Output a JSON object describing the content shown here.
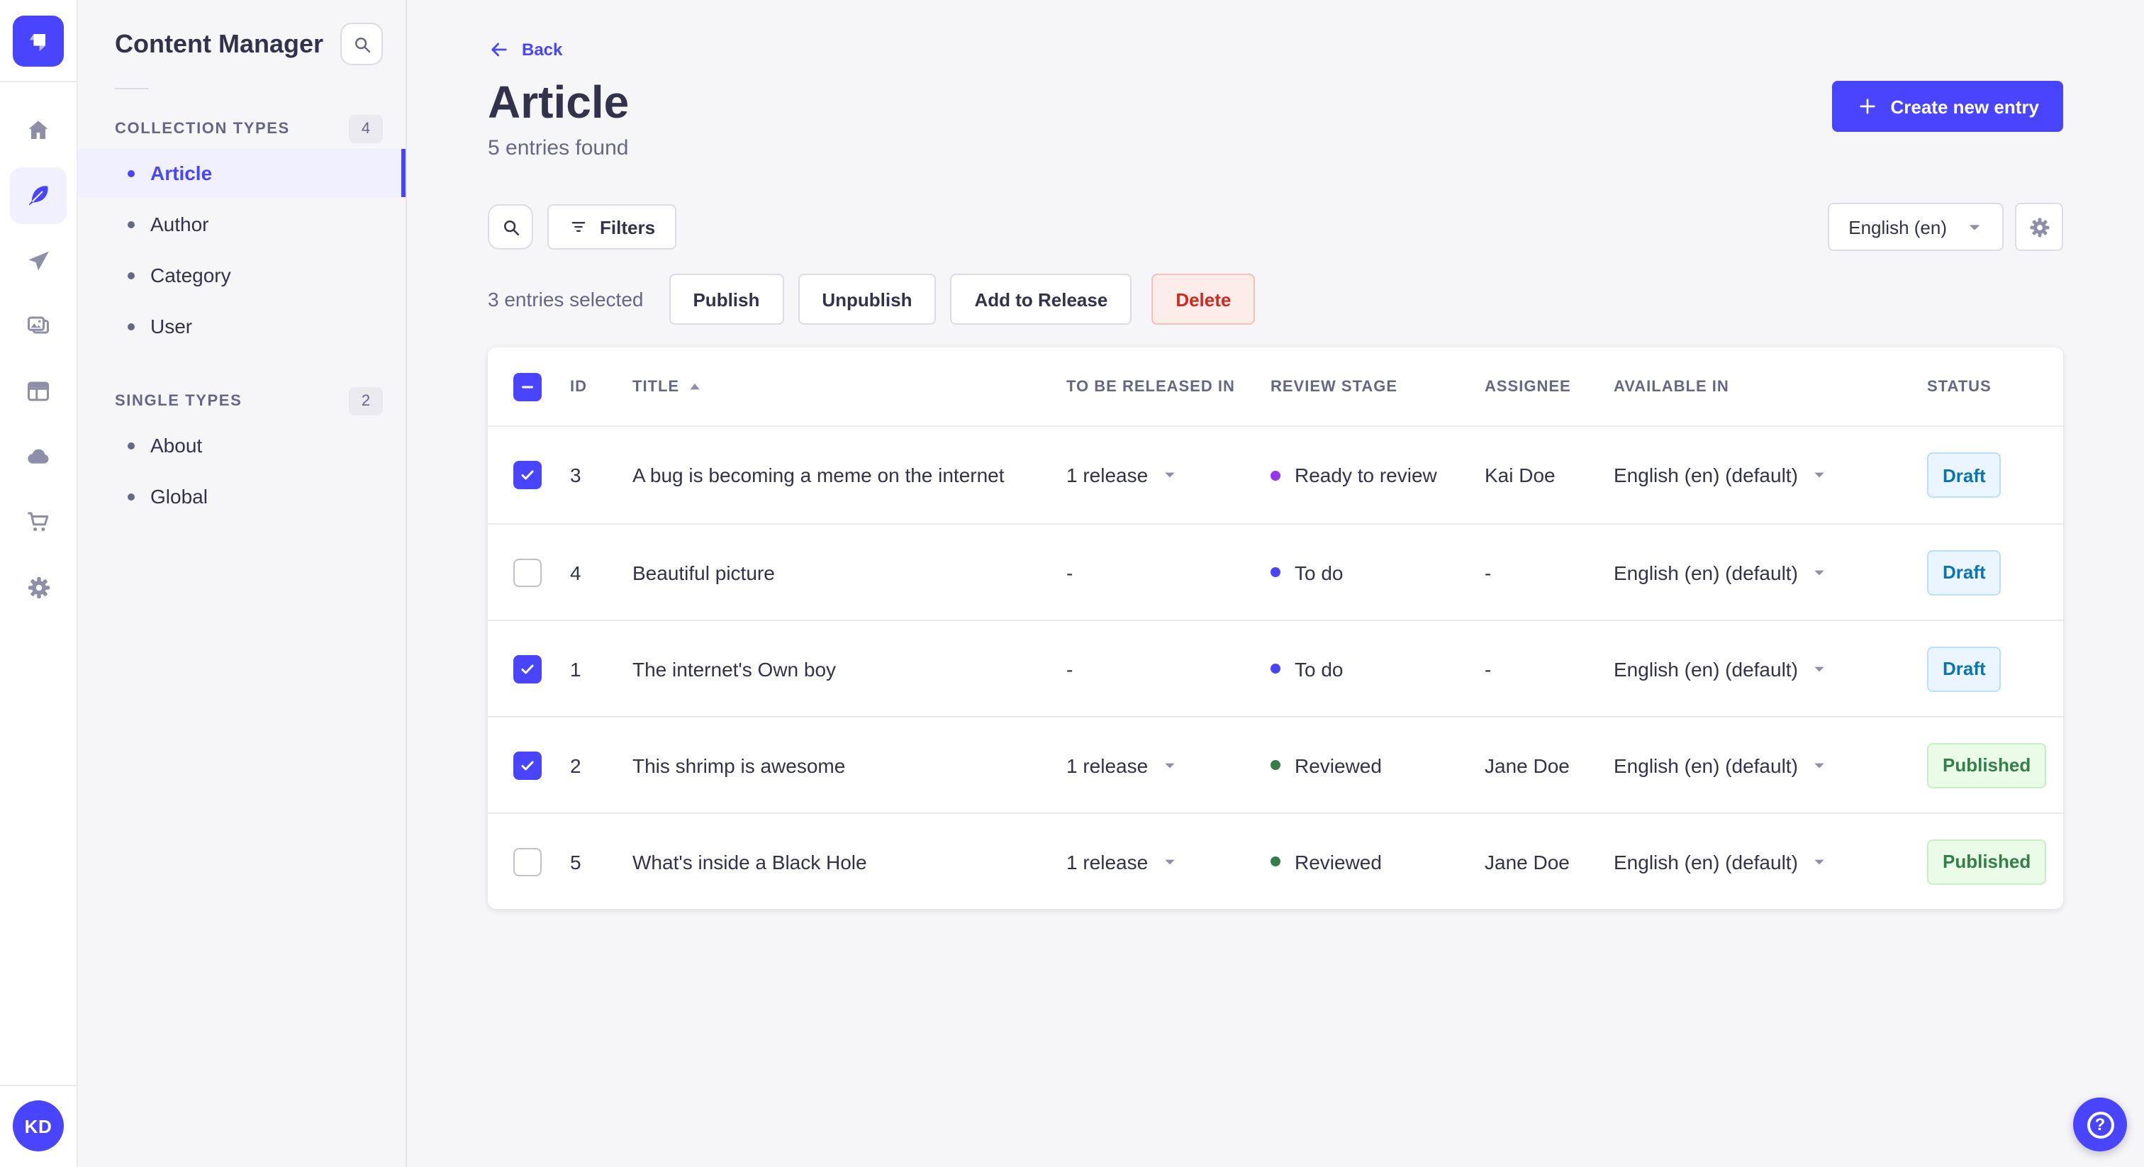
{
  "rail": {
    "avatar_initials": "KD",
    "items": [
      {
        "name": "home"
      },
      {
        "name": "content-manager",
        "active": true
      },
      {
        "name": "releases"
      },
      {
        "name": "media-library"
      },
      {
        "name": "content-type-builder"
      },
      {
        "name": "deploy"
      },
      {
        "name": "marketplace"
      },
      {
        "name": "settings"
      }
    ]
  },
  "subnav": {
    "title": "Content Manager",
    "sections": [
      {
        "label": "COLLECTION TYPES",
        "count": "4",
        "items": [
          {
            "label": "Article",
            "active": true
          },
          {
            "label": "Author"
          },
          {
            "label": "Category"
          },
          {
            "label": "User"
          }
        ]
      },
      {
        "label": "SINGLE TYPES",
        "count": "2",
        "items": [
          {
            "label": "About"
          },
          {
            "label": "Global"
          }
        ]
      }
    ]
  },
  "page": {
    "back_label": "Back",
    "title": "Article",
    "subtitle": "5 entries found",
    "create_button_label": "Create new entry"
  },
  "toolbar": {
    "filters_label": "Filters",
    "locale_value": "English (en)"
  },
  "selection": {
    "summary": "3 entries selected",
    "publish_label": "Publish",
    "unpublish_label": "Unpublish",
    "add_to_release_label": "Add to Release",
    "delete_label": "Delete"
  },
  "table": {
    "columns": {
      "id": "ID",
      "title": "TITLE",
      "release": "TO BE RELEASED IN",
      "stage": "REVIEW STAGE",
      "assignee": "ASSIGNEE",
      "available": "AVAILABLE IN",
      "status": "STATUS"
    },
    "sort": {
      "column": "TITLE",
      "direction": "ascending"
    },
    "rows": [
      {
        "selected": true,
        "id": "3",
        "title": "A bug is becoming a meme on the internet",
        "release": "1 release",
        "stage": "Ready to review",
        "stage_color": "#9736e8",
        "assignee": "Kai Doe",
        "available": "English (en) (default)",
        "status": "Draft"
      },
      {
        "selected": false,
        "id": "4",
        "title": "Beautiful picture",
        "release": "-",
        "stage": "To do",
        "stage_color": "#4945ff",
        "assignee": "-",
        "available": "English (en) (default)",
        "status": "Draft"
      },
      {
        "selected": true,
        "id": "1",
        "title": "The internet's Own boy",
        "release": "-",
        "stage": "To do",
        "stage_color": "#4945ff",
        "assignee": "-",
        "available": "English (en) (default)",
        "status": "Draft"
      },
      {
        "selected": true,
        "id": "2",
        "title": "This shrimp is awesome",
        "release": "1 release",
        "stage": "Reviewed",
        "stage_color": "#328048",
        "assignee": "Jane Doe",
        "available": "English (en) (default)",
        "status": "Published"
      },
      {
        "selected": false,
        "id": "5",
        "title": "What's inside a Black Hole",
        "release": "1 release",
        "stage": "Reviewed",
        "stage_color": "#328048",
        "assignee": "Jane Doe",
        "available": "English (en) (default)",
        "status": "Published"
      }
    ]
  },
  "colors": {
    "primary": "#4945ff",
    "primary_light_bg": "#f0f0ff",
    "status_draft_text": "#0c75af",
    "status_draft_bg": "#eaf5ff",
    "status_published_text": "#328048",
    "status_published_bg": "#eafbe7",
    "delete_text": "#d02b20",
    "delete_bg": "#fcecea",
    "stage_todo": "#4945ff",
    "stage_ready_to_review": "#9736e8",
    "stage_reviewed": "#328048"
  }
}
